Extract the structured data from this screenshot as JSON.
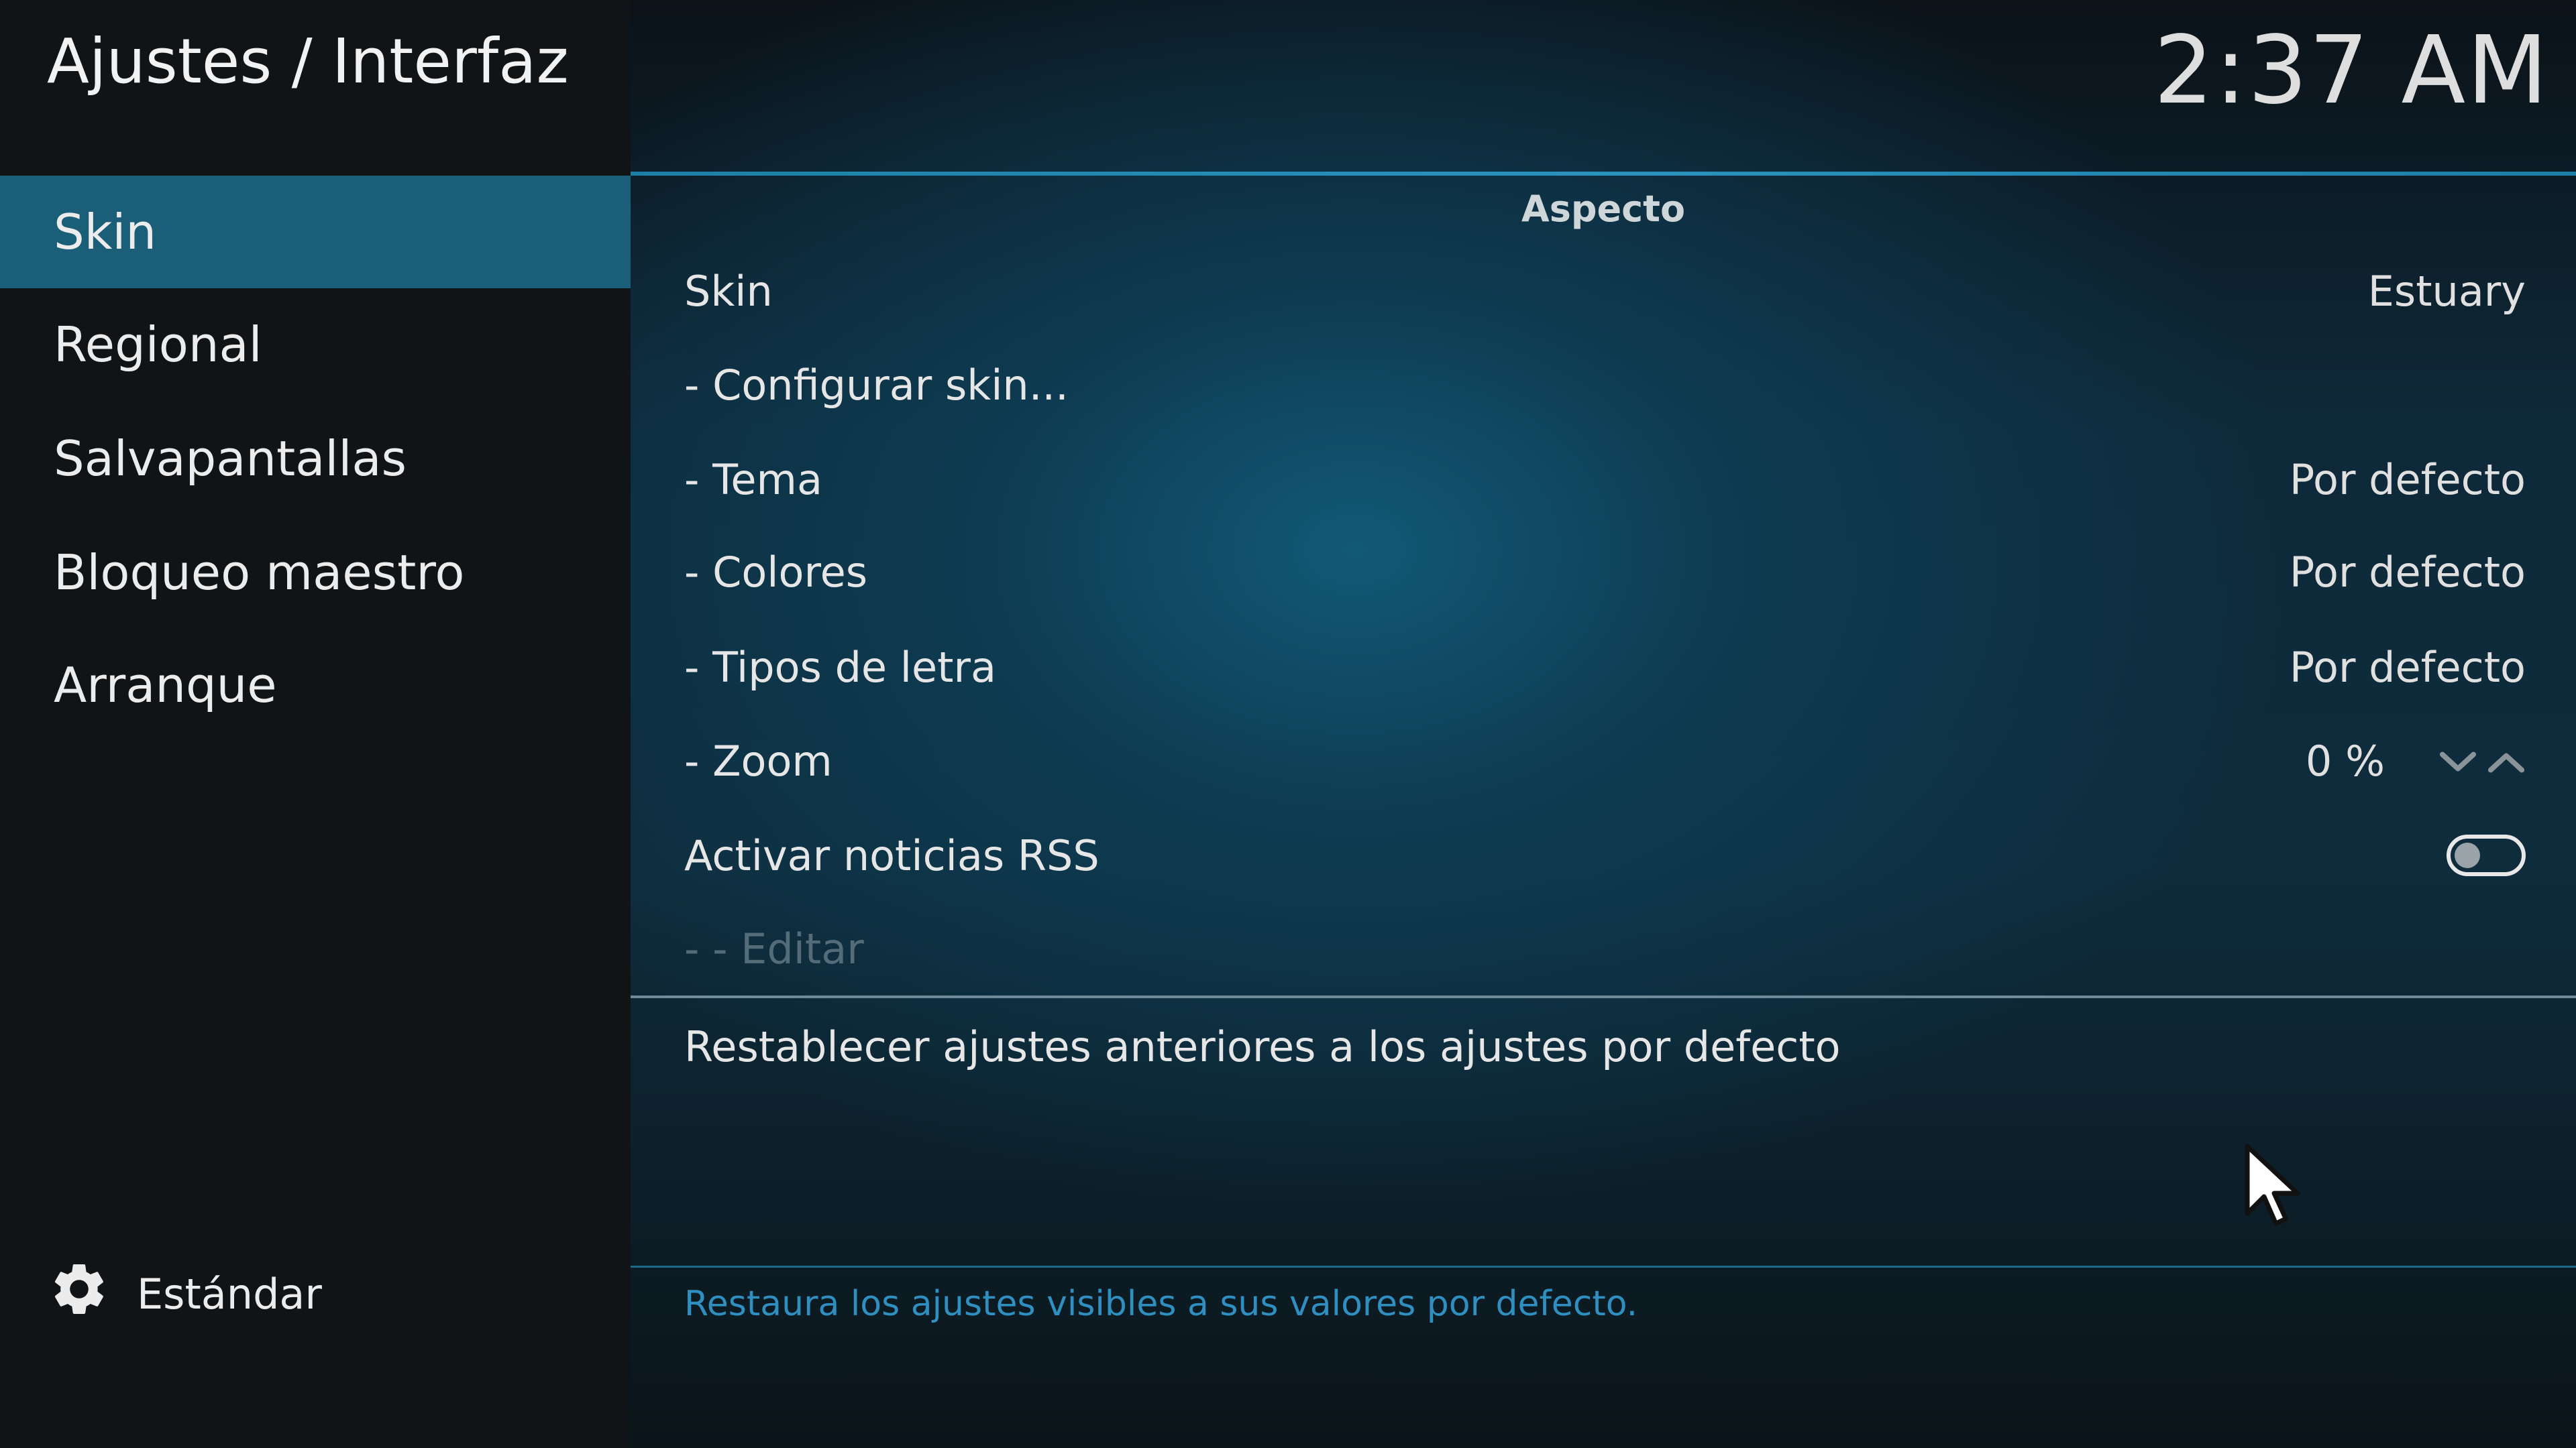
{
  "header": {
    "title": "Ajustes / Interfaz",
    "clock": "2:37 AM"
  },
  "sidebar": {
    "items": [
      {
        "label": "Skin",
        "active": true
      },
      {
        "label": "Regional",
        "active": false
      },
      {
        "label": "Salvapantallas",
        "active": false
      },
      {
        "label": "Bloqueo maestro",
        "active": false
      },
      {
        "label": "Arranque",
        "active": false
      }
    ],
    "level_button": {
      "label": "Estándar",
      "icon": "gear-icon"
    }
  },
  "main": {
    "section_title": "Aspecto",
    "rows": [
      {
        "label": "Skin",
        "value": "Estuary"
      },
      {
        "label": "- Configurar skin...",
        "value": ""
      },
      {
        "label": "- Tema",
        "value": "Por defecto"
      },
      {
        "label": "- Colores",
        "value": "Por defecto"
      },
      {
        "label": "- Tipos de letra",
        "value": "Por defecto"
      },
      {
        "label": "- Zoom",
        "value": "0 %",
        "control": "spinner"
      },
      {
        "label": "Activar noticias RSS",
        "value": "",
        "control": "toggle",
        "toggle_on": false
      },
      {
        "label": "- - Editar",
        "value": "",
        "disabled": true
      }
    ],
    "reset_label": "Restablecer ajustes anteriores a los ajustes por defecto",
    "help_text": "Restaura los ajustes visibles a sus valores por defecto."
  },
  "colors": {
    "accent": "#1b5e78",
    "rule": "#2a93bd",
    "help_text": "#2f8fc0",
    "disabled_text": "#546b78"
  }
}
